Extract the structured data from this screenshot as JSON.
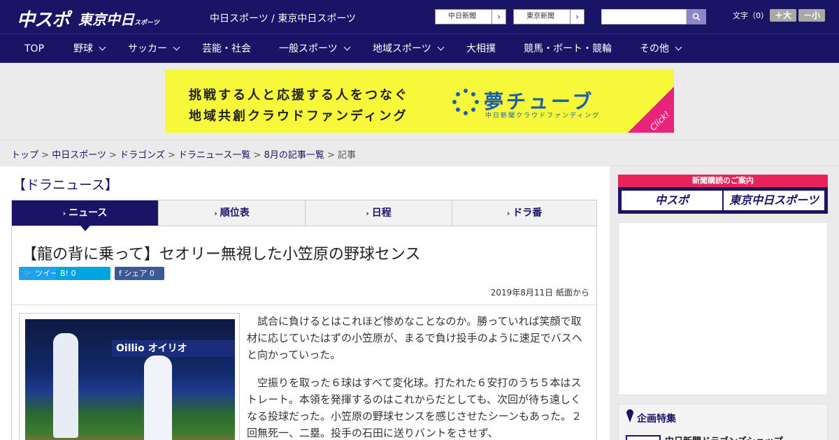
{
  "header": {
    "logo_main": "中スポ",
    "logo_sub": "東京中日",
    "logo_sub_small": "スポーツ",
    "site_names": "中日スポーツ / 東京中日スポーツ",
    "paper_buttons": [
      "中日新聞",
      "東京新聞"
    ],
    "font_label": "文字（0）",
    "font_plus": "＋大",
    "font_minus": "－小"
  },
  "nav": {
    "items": [
      {
        "label": "TOP",
        "chevron": false
      },
      {
        "label": "野球",
        "chevron": true
      },
      {
        "label": "サッカー",
        "chevron": true
      },
      {
        "label": "芸能・社会",
        "chevron": false
      },
      {
        "label": "一般スポーツ",
        "chevron": true
      },
      {
        "label": "地域スポーツ",
        "chevron": true
      },
      {
        "label": "大相撲",
        "chevron": false
      },
      {
        "label": "競馬・ボート・競輪",
        "chevron": false
      },
      {
        "label": "その他",
        "chevron": true
      }
    ]
  },
  "banner": {
    "line1": "挑戦する人と応援する人をつなぐ",
    "line2": "地域共創クラウドファンディング",
    "brand": "夢チューブ",
    "brand_sub": "中日新聞クラウドファンディング",
    "click": "Click!"
  },
  "breadcrumb": {
    "items": [
      "トップ",
      "中日スポーツ",
      "ドラゴンズ",
      "ドラニュース一覧",
      "8月の記事一覧"
    ],
    "current": "記事"
  },
  "section_title": "【ドラニュース】",
  "tabs": [
    "ニュース",
    "順位表",
    "日程",
    "ドラ番"
  ],
  "article": {
    "headline": "【龍の背に乗って】セオリー無視した小笠原の野球センス",
    "share_tweet": "ツイート",
    "share_hatena": "B! 0",
    "share_fb": "シェア 0",
    "date": "2019年8月11日 紙面から",
    "photo_sign": "Oillio オイリオ",
    "paragraphs": [
      "試合に負けるとはこれほど惨めなことなのか。勝っていれば笑顔で取材に応じていたはずの小笠原が、まるで負け投手のように速足でバスへと向かっていった。",
      "空振りを取った６球はすべて変化球。打たれた６安打のうち５本はストレート。本領を発揮するのはこれからだとしても、次回が待ち遠しくなる投球だった。小笠原の野球センスを感じさせたシーンもあった。２回無死一、二塁。投手の石田に送りバントをさせず、"
    ]
  },
  "sidebar": {
    "subscribe_title": "新聞購読のご案内",
    "subscribe_buttons": [
      "中スポ",
      "東京中日スポーツ"
    ],
    "feature_title": "企画特集",
    "feature_item": "中日新聞ドラゴンズショップ"
  },
  "colors": {
    "brand_navy": "#1a1466",
    "banner_yellow": "#f8f83a",
    "accent_pink": "#e8235a"
  }
}
